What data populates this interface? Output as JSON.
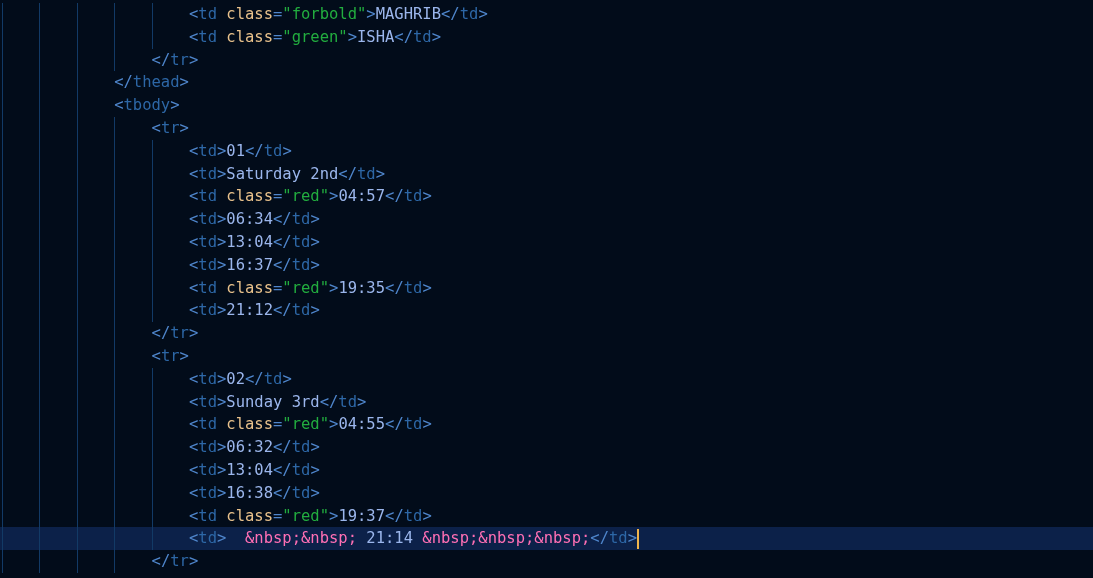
{
  "editor": {
    "lines": [
      {
        "children": [
          {
            "children": [
              {
                "active": false,
                "tokens": [
                  {
                    "kind": "punct",
                    "text": "<"
                  },
                  {
                    "kind": "tag",
                    "text": "td"
                  },
                  {
                    "kind": "attr",
                    "text": " class"
                  },
                  {
                    "kind": "punct",
                    "text": "="
                  },
                  {
                    "kind": "string",
                    "text": "\"forbold\""
                  },
                  {
                    "kind": "punct",
                    "text": ">"
                  },
                  {
                    "kind": "text",
                    "text": "MAGHRIB"
                  },
                  {
                    "kind": "punct",
                    "text": "</"
                  },
                  {
                    "kind": "tag",
                    "text": "td"
                  },
                  {
                    "kind": "punct",
                    "text": ">"
                  }
                ]
              },
              {
                "active": false,
                "tokens": [
                  {
                    "kind": "punct",
                    "text": "<"
                  },
                  {
                    "kind": "tag",
                    "text": "td"
                  },
                  {
                    "kind": "attr",
                    "text": " class"
                  },
                  {
                    "kind": "punct",
                    "text": "="
                  },
                  {
                    "kind": "string",
                    "text": "\"green\""
                  },
                  {
                    "kind": "punct",
                    "text": ">"
                  },
                  {
                    "kind": "text",
                    "text": "ISHA"
                  },
                  {
                    "kind": "punct",
                    "text": "</"
                  },
                  {
                    "kind": "tag",
                    "text": "td"
                  },
                  {
                    "kind": "punct",
                    "text": ">"
                  }
                ]
              }
            ]
          },
          {
            "active": false,
            "tokens": [
              {
                "kind": "punct",
                "text": "</"
              },
              {
                "kind": "tag",
                "text": "tr"
              },
              {
                "kind": "punct",
                "text": ">"
              }
            ]
          }
        ]
      },
      {
        "active": false,
        "tokens": [
          {
            "kind": "punct",
            "text": "</"
          },
          {
            "kind": "tag",
            "text": "thead"
          },
          {
            "kind": "punct",
            "text": ">"
          }
        ]
      },
      {
        "active": false,
        "tokens": [
          {
            "kind": "punct",
            "text": "<"
          },
          {
            "kind": "tag",
            "text": "tbody"
          },
          {
            "kind": "punct",
            "text": ">"
          }
        ]
      },
      {
        "children": [
          {
            "active": false,
            "tokens": [
              {
                "kind": "punct",
                "text": "<"
              },
              {
                "kind": "tag",
                "text": "tr"
              },
              {
                "kind": "punct",
                "text": ">"
              }
            ]
          },
          {
            "children": [
              {
                "active": false,
                "tokens": [
                  {
                    "kind": "punct",
                    "text": "<"
                  },
                  {
                    "kind": "tag",
                    "text": "td"
                  },
                  {
                    "kind": "punct",
                    "text": ">"
                  },
                  {
                    "kind": "text",
                    "text": "01"
                  },
                  {
                    "kind": "punct",
                    "text": "</"
                  },
                  {
                    "kind": "tag",
                    "text": "td"
                  },
                  {
                    "kind": "punct",
                    "text": ">"
                  }
                ]
              },
              {
                "active": false,
                "tokens": [
                  {
                    "kind": "punct",
                    "text": "<"
                  },
                  {
                    "kind": "tag",
                    "text": "td"
                  },
                  {
                    "kind": "punct",
                    "text": ">"
                  },
                  {
                    "kind": "text",
                    "text": "Saturday 2nd"
                  },
                  {
                    "kind": "punct",
                    "text": "</"
                  },
                  {
                    "kind": "tag",
                    "text": "td"
                  },
                  {
                    "kind": "punct",
                    "text": ">"
                  }
                ]
              },
              {
                "active": false,
                "tokens": [
                  {
                    "kind": "punct",
                    "text": "<"
                  },
                  {
                    "kind": "tag",
                    "text": "td"
                  },
                  {
                    "kind": "attr",
                    "text": " class"
                  },
                  {
                    "kind": "punct",
                    "text": "="
                  },
                  {
                    "kind": "string",
                    "text": "\"red\""
                  },
                  {
                    "kind": "punct",
                    "text": ">"
                  },
                  {
                    "kind": "text",
                    "text": "04:57"
                  },
                  {
                    "kind": "punct",
                    "text": "</"
                  },
                  {
                    "kind": "tag",
                    "text": "td"
                  },
                  {
                    "kind": "punct",
                    "text": ">"
                  }
                ]
              },
              {
                "active": false,
                "tokens": [
                  {
                    "kind": "punct",
                    "text": "<"
                  },
                  {
                    "kind": "tag",
                    "text": "td"
                  },
                  {
                    "kind": "punct",
                    "text": ">"
                  },
                  {
                    "kind": "text",
                    "text": "06:34"
                  },
                  {
                    "kind": "punct",
                    "text": "</"
                  },
                  {
                    "kind": "tag",
                    "text": "td"
                  },
                  {
                    "kind": "punct",
                    "text": ">"
                  }
                ]
              },
              {
                "active": false,
                "tokens": [
                  {
                    "kind": "punct",
                    "text": "<"
                  },
                  {
                    "kind": "tag",
                    "text": "td"
                  },
                  {
                    "kind": "punct",
                    "text": ">"
                  },
                  {
                    "kind": "text",
                    "text": "13:04"
                  },
                  {
                    "kind": "punct",
                    "text": "</"
                  },
                  {
                    "kind": "tag",
                    "text": "td"
                  },
                  {
                    "kind": "punct",
                    "text": ">"
                  }
                ]
              },
              {
                "active": false,
                "tokens": [
                  {
                    "kind": "punct",
                    "text": "<"
                  },
                  {
                    "kind": "tag",
                    "text": "td"
                  },
                  {
                    "kind": "punct",
                    "text": ">"
                  },
                  {
                    "kind": "text",
                    "text": "16:37"
                  },
                  {
                    "kind": "punct",
                    "text": "</"
                  },
                  {
                    "kind": "tag",
                    "text": "td"
                  },
                  {
                    "kind": "punct",
                    "text": ">"
                  }
                ]
              },
              {
                "active": false,
                "tokens": [
                  {
                    "kind": "punct",
                    "text": "<"
                  },
                  {
                    "kind": "tag",
                    "text": "td"
                  },
                  {
                    "kind": "attr",
                    "text": " class"
                  },
                  {
                    "kind": "punct",
                    "text": "="
                  },
                  {
                    "kind": "string",
                    "text": "\"red\""
                  },
                  {
                    "kind": "punct",
                    "text": ">"
                  },
                  {
                    "kind": "text",
                    "text": "19:35"
                  },
                  {
                    "kind": "punct",
                    "text": "</"
                  },
                  {
                    "kind": "tag",
                    "text": "td"
                  },
                  {
                    "kind": "punct",
                    "text": ">"
                  }
                ]
              },
              {
                "active": false,
                "tokens": [
                  {
                    "kind": "punct",
                    "text": "<"
                  },
                  {
                    "kind": "tag",
                    "text": "td"
                  },
                  {
                    "kind": "punct",
                    "text": ">"
                  },
                  {
                    "kind": "text",
                    "text": "21:12"
                  },
                  {
                    "kind": "punct",
                    "text": "</"
                  },
                  {
                    "kind": "tag",
                    "text": "td"
                  },
                  {
                    "kind": "punct",
                    "text": ">"
                  }
                ]
              }
            ]
          },
          {
            "active": false,
            "tokens": [
              {
                "kind": "punct",
                "text": "</"
              },
              {
                "kind": "tag",
                "text": "tr"
              },
              {
                "kind": "punct",
                "text": ">"
              }
            ]
          },
          {
            "active": false,
            "tokens": [
              {
                "kind": "punct",
                "text": "<"
              },
              {
                "kind": "tag",
                "text": "tr"
              },
              {
                "kind": "punct",
                "text": ">"
              }
            ]
          },
          {
            "children": [
              {
                "active": false,
                "tokens": [
                  {
                    "kind": "punct",
                    "text": "<"
                  },
                  {
                    "kind": "tag",
                    "text": "td"
                  },
                  {
                    "kind": "punct",
                    "text": ">"
                  },
                  {
                    "kind": "text",
                    "text": "02"
                  },
                  {
                    "kind": "punct",
                    "text": "</"
                  },
                  {
                    "kind": "tag",
                    "text": "td"
                  },
                  {
                    "kind": "punct",
                    "text": ">"
                  }
                ]
              },
              {
                "active": false,
                "tokens": [
                  {
                    "kind": "punct",
                    "text": "<"
                  },
                  {
                    "kind": "tag",
                    "text": "td"
                  },
                  {
                    "kind": "punct",
                    "text": ">"
                  },
                  {
                    "kind": "text",
                    "text": "Sunday 3rd"
                  },
                  {
                    "kind": "punct",
                    "text": "</"
                  },
                  {
                    "kind": "tag",
                    "text": "td"
                  },
                  {
                    "kind": "punct",
                    "text": ">"
                  }
                ]
              },
              {
                "active": false,
                "tokens": [
                  {
                    "kind": "punct",
                    "text": "<"
                  },
                  {
                    "kind": "tag",
                    "text": "td"
                  },
                  {
                    "kind": "attr",
                    "text": " class"
                  },
                  {
                    "kind": "punct",
                    "text": "="
                  },
                  {
                    "kind": "string",
                    "text": "\"red\""
                  },
                  {
                    "kind": "punct",
                    "text": ">"
                  },
                  {
                    "kind": "text",
                    "text": "04:55"
                  },
                  {
                    "kind": "punct",
                    "text": "</"
                  },
                  {
                    "kind": "tag",
                    "text": "td"
                  },
                  {
                    "kind": "punct",
                    "text": ">"
                  }
                ]
              },
              {
                "active": false,
                "tokens": [
                  {
                    "kind": "punct",
                    "text": "<"
                  },
                  {
                    "kind": "tag",
                    "text": "td"
                  },
                  {
                    "kind": "punct",
                    "text": ">"
                  },
                  {
                    "kind": "text",
                    "text": "06:32"
                  },
                  {
                    "kind": "punct",
                    "text": "</"
                  },
                  {
                    "kind": "tag",
                    "text": "td"
                  },
                  {
                    "kind": "punct",
                    "text": ">"
                  }
                ]
              },
              {
                "active": false,
                "tokens": [
                  {
                    "kind": "punct",
                    "text": "<"
                  },
                  {
                    "kind": "tag",
                    "text": "td"
                  },
                  {
                    "kind": "punct",
                    "text": ">"
                  },
                  {
                    "kind": "text",
                    "text": "13:04"
                  },
                  {
                    "kind": "punct",
                    "text": "</"
                  },
                  {
                    "kind": "tag",
                    "text": "td"
                  },
                  {
                    "kind": "punct",
                    "text": ">"
                  }
                ]
              },
              {
                "active": false,
                "tokens": [
                  {
                    "kind": "punct",
                    "text": "<"
                  },
                  {
                    "kind": "tag",
                    "text": "td"
                  },
                  {
                    "kind": "punct",
                    "text": ">"
                  },
                  {
                    "kind": "text",
                    "text": "16:38"
                  },
                  {
                    "kind": "punct",
                    "text": "</"
                  },
                  {
                    "kind": "tag",
                    "text": "td"
                  },
                  {
                    "kind": "punct",
                    "text": ">"
                  }
                ]
              },
              {
                "active": false,
                "tokens": [
                  {
                    "kind": "punct",
                    "text": "<"
                  },
                  {
                    "kind": "tag",
                    "text": "td"
                  },
                  {
                    "kind": "attr",
                    "text": " class"
                  },
                  {
                    "kind": "punct",
                    "text": "="
                  },
                  {
                    "kind": "string",
                    "text": "\"red\""
                  },
                  {
                    "kind": "punct",
                    "text": ">"
                  },
                  {
                    "kind": "text",
                    "text": "19:37"
                  },
                  {
                    "kind": "punct",
                    "text": "</"
                  },
                  {
                    "kind": "tag",
                    "text": "td"
                  },
                  {
                    "kind": "punct",
                    "text": ">"
                  }
                ]
              },
              {
                "active": true,
                "tokens": [
                  {
                    "kind": "punct",
                    "text": "<"
                  },
                  {
                    "kind": "tag",
                    "text": "td"
                  },
                  {
                    "kind": "punct",
                    "text": ">"
                  },
                  {
                    "kind": "entity",
                    "text": "  &nbsp;&nbsp;"
                  },
                  {
                    "kind": "text",
                    "text": " 21:14 "
                  },
                  {
                    "kind": "entity",
                    "text": "&nbsp;&nbsp;&nbsp;"
                  },
                  {
                    "kind": "punct",
                    "text": "</"
                  },
                  {
                    "kind": "tag",
                    "text": "td"
                  },
                  {
                    "kind": "punct",
                    "text": ">"
                  }
                ]
              }
            ]
          },
          {
            "active": false,
            "tokens": [
              {
                "kind": "punct",
                "text": "</"
              },
              {
                "kind": "tag",
                "text": "tr"
              },
              {
                "kind": "punct",
                "text": ">"
              }
            ]
          }
        ]
      }
    ]
  }
}
